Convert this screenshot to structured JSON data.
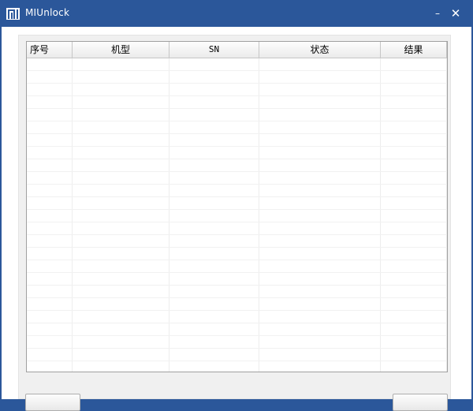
{
  "window": {
    "title": "MIUnlock",
    "minimize_label": "–",
    "close_label": "✕"
  },
  "table": {
    "columns": [
      "序号",
      "机型",
      "SN",
      "状态",
      "结果"
    ],
    "rows": []
  },
  "colors": {
    "titlebar": "#2b579a",
    "panel": "#f0f0f0"
  },
  "icons": {
    "app_logo": "mi-logo-icon",
    "minimize": "minimize-icon",
    "close": "close-icon"
  }
}
